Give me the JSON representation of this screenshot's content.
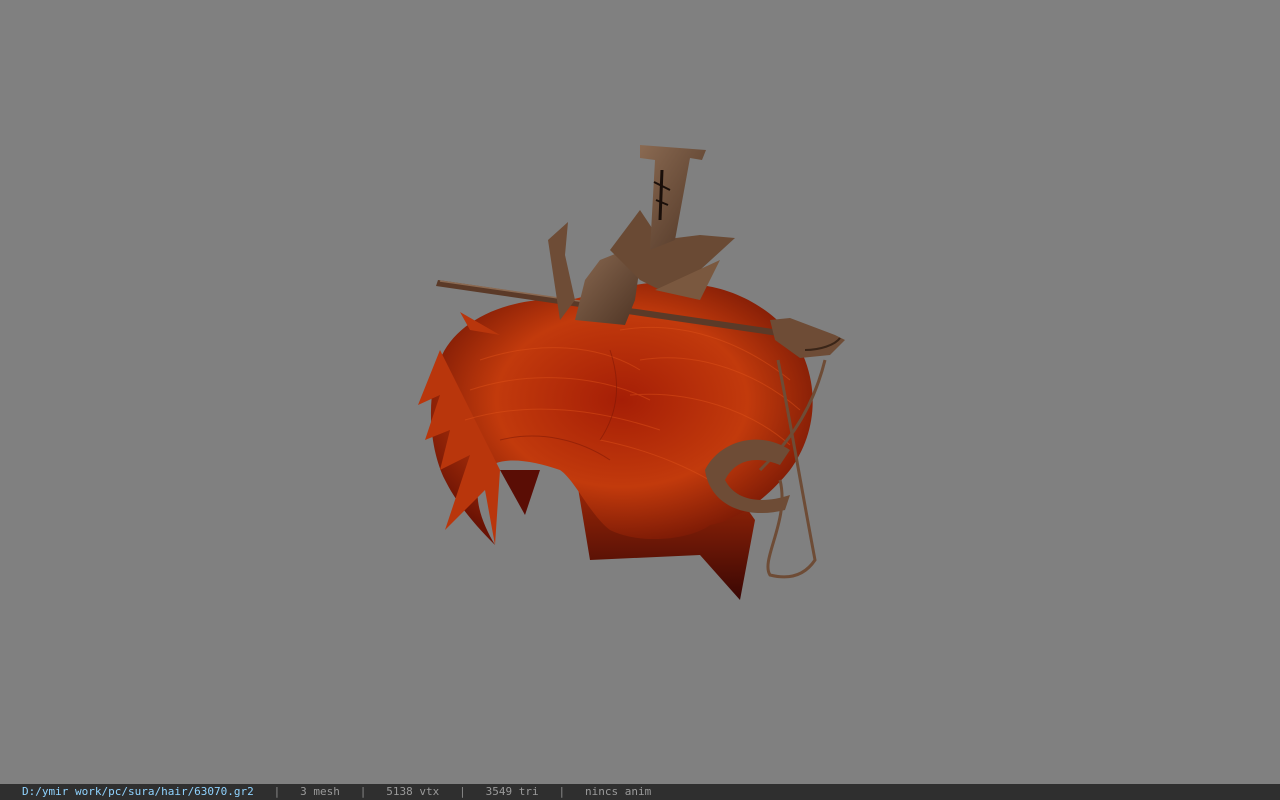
{
  "viewer": {
    "background": "#808080",
    "model_name": "sura hair 63070"
  },
  "status": {
    "file_path": "D:/ymir work/pc/sura/hair/63070.gr2",
    "mesh": "3 mesh",
    "vtx": "5138 vtx",
    "tri": "3549 tri",
    "anim": "nincs anim",
    "separator": "|",
    "path_color": "#8fd3ff"
  }
}
